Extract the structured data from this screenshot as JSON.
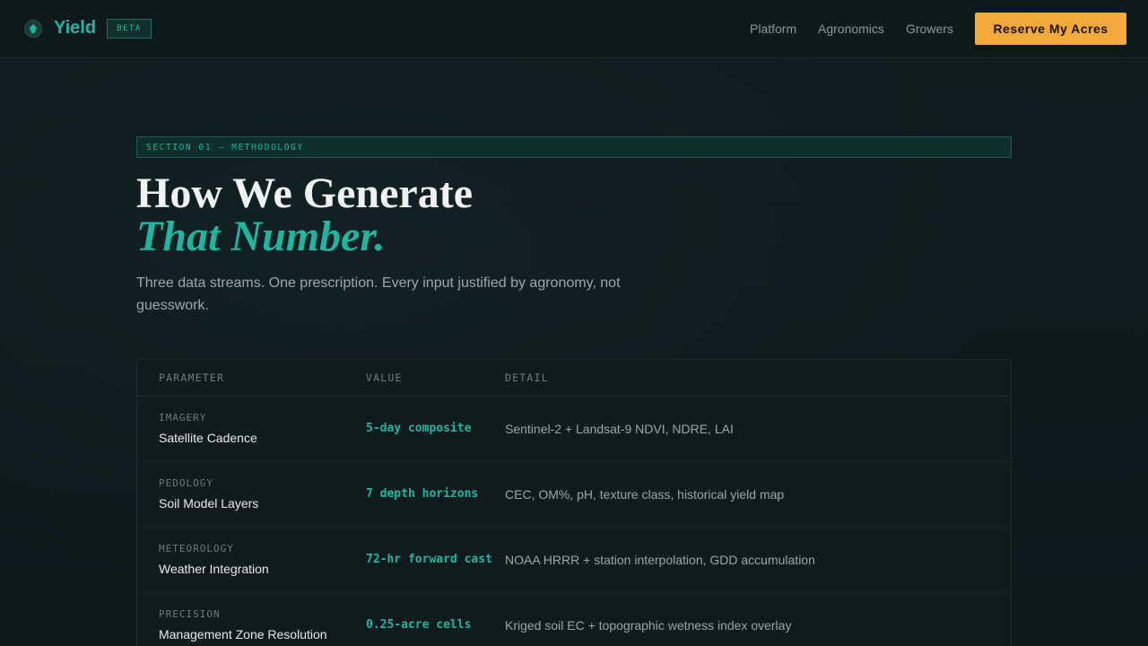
{
  "nav": {
    "brand": "Yield",
    "badge": "BETA",
    "links": [
      "Platform",
      "Agronomics",
      "Growers"
    ],
    "cta": "Reserve My Acres"
  },
  "section": {
    "tag": "SECTION 01 — METHODOLOGY",
    "title_line1": "How We Generate",
    "title_line2": "That Number.",
    "subtitle": "Three data streams. One prescription. Every input justified by agronomy, not guesswork."
  },
  "table": {
    "headers": [
      "PARAMETER",
      "VALUE",
      "DETAIL"
    ],
    "rows": [
      {
        "category": "IMAGERY",
        "parameter": "Satellite Cadence",
        "value": "5-day composite",
        "detail": "Sentinel-2 + Landsat-9 NDVI, NDRE, LAI"
      },
      {
        "category": "PEDOLOGY",
        "parameter": "Soil Model Layers",
        "value": "7 depth horizons",
        "detail": "CEC, OM%, pH, texture class, historical yield map"
      },
      {
        "category": "METEOROLOGY",
        "parameter": "Weather Integration",
        "value": "72-hr forward cast",
        "detail": "NOAA HRRR + station interpolation, GDD accumulation"
      },
      {
        "category": "PRECISION",
        "parameter": "Management Zone Resolution",
        "value": "0.25-acre cells",
        "detail": "Kriged soil EC + topographic wetness index overlay"
      }
    ]
  },
  "colors": {
    "accent": "#1fb5a0",
    "cta": "#f2a93b",
    "background": "#0d1a1c"
  }
}
